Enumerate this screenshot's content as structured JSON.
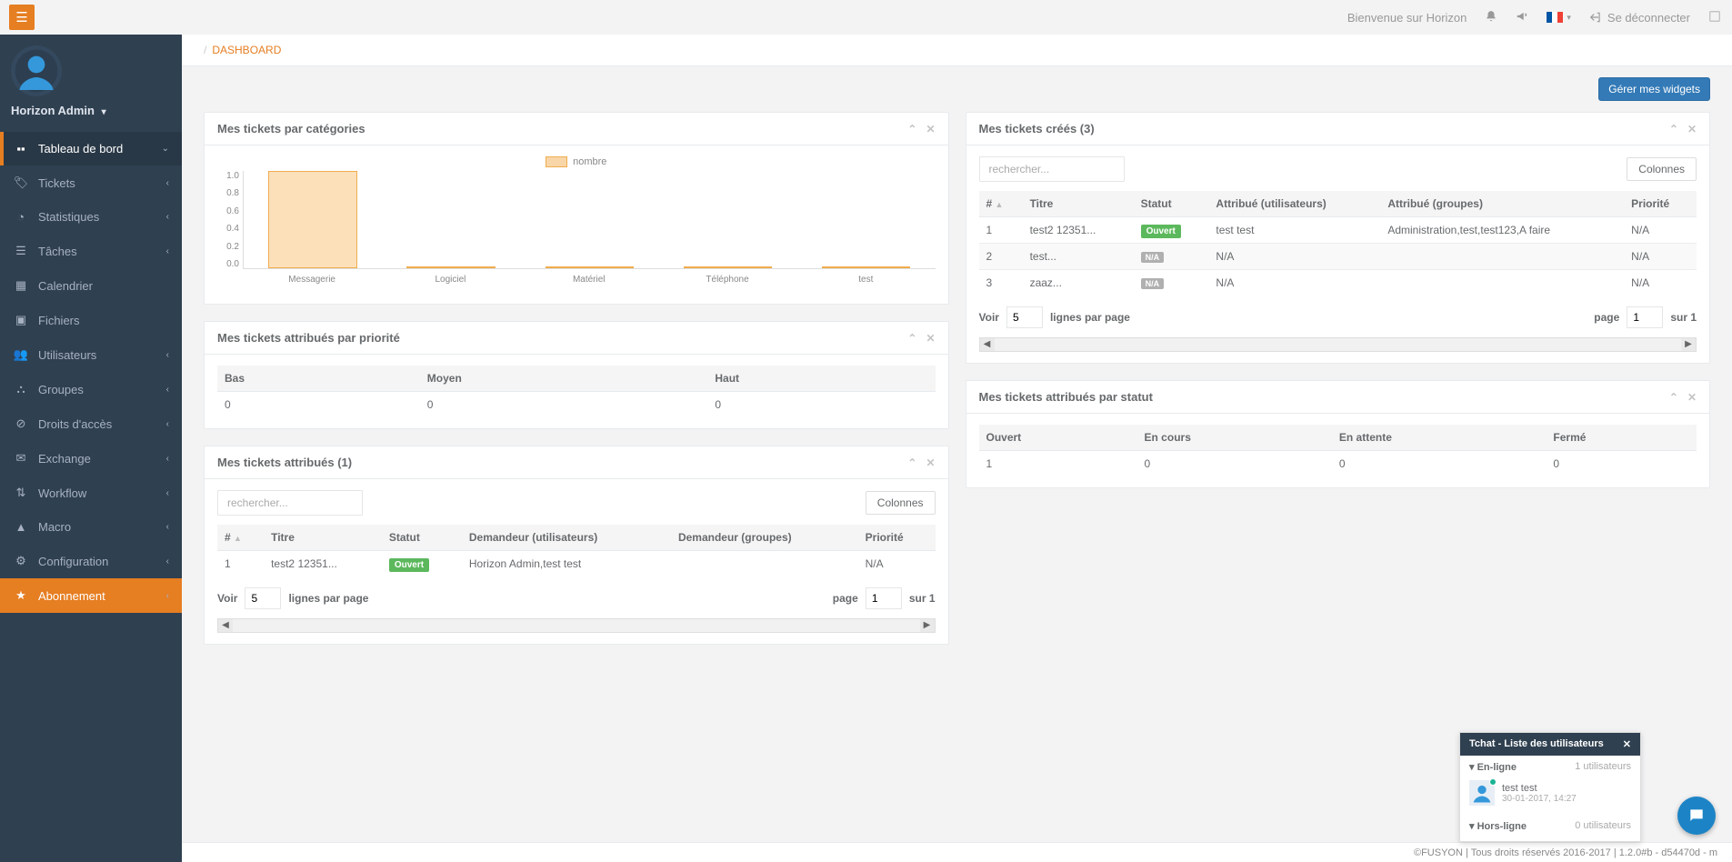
{
  "topbar": {
    "welcome": "Bienvenue sur Horizon",
    "logout": "Se déconnecter"
  },
  "profile": {
    "username": "Horizon Admin"
  },
  "sidebar": {
    "items": [
      {
        "icon": "dashboard",
        "label": "Tableau de bord",
        "active": true
      },
      {
        "icon": "tag",
        "label": "Tickets"
      },
      {
        "icon": "dashboard",
        "label": "Statistiques"
      },
      {
        "icon": "list",
        "label": "Tâches"
      },
      {
        "icon": "calendar",
        "label": "Calendrier"
      },
      {
        "icon": "folder",
        "label": "Fichiers"
      },
      {
        "icon": "users",
        "label": "Utilisateurs"
      },
      {
        "icon": "group",
        "label": "Groupes"
      },
      {
        "icon": "lock",
        "label": "Droits d'accès"
      },
      {
        "icon": "envelope",
        "label": "Exchange"
      },
      {
        "icon": "workflow",
        "label": "Workflow"
      },
      {
        "icon": "macro",
        "label": "Macro"
      },
      {
        "icon": "gear",
        "label": "Configuration"
      },
      {
        "icon": "star",
        "label": "Abonnement",
        "highlight": true
      }
    ]
  },
  "breadcrumb": "DASHBOARD",
  "buttons": {
    "manage_widgets": "Gérer mes widgets",
    "columns": "Colonnes"
  },
  "widgets": {
    "by_category": {
      "title": "Mes tickets par catégories",
      "legend": "nombre"
    },
    "by_priority": {
      "title": "Mes tickets attribués par priorité",
      "headers": {
        "low": "Bas",
        "medium": "Moyen",
        "high": "Haut"
      },
      "values": {
        "low": "0",
        "medium": "0",
        "high": "0"
      }
    },
    "assigned": {
      "title": "Mes tickets attribués (1)",
      "search_placeholder": "rechercher...",
      "headers": {
        "num": "#",
        "title": "Titre",
        "status": "Statut",
        "req_users": "Demandeur (utilisateurs)",
        "req_groups": "Demandeur (groupes)",
        "priority": "Priorité"
      },
      "rows": [
        {
          "num": "1",
          "title": "test2 12351...",
          "status": "Ouvert",
          "req_users": "Horizon Admin,test test",
          "req_groups": "",
          "priority": "N/A"
        }
      ]
    },
    "created": {
      "title": "Mes tickets créés (3)",
      "search_placeholder": "rechercher...",
      "headers": {
        "num": "#",
        "title": "Titre",
        "status": "Statut",
        "assigned_users": "Attribué (utilisateurs)",
        "assigned_groups": "Attribué (groupes)",
        "priority": "Priorité"
      },
      "rows": [
        {
          "num": "1",
          "title": "test2 12351...",
          "status": "Ouvert",
          "status_kind": "open",
          "assigned_users": "test test",
          "assigned_groups": "Administration,test,test123,A faire",
          "priority": "N/A"
        },
        {
          "num": "2",
          "title": "test...",
          "status": "N/A",
          "status_kind": "na",
          "assigned_users": "N/A",
          "assigned_groups": "",
          "priority": "N/A"
        },
        {
          "num": "3",
          "title": "zaaz...",
          "status": "N/A",
          "status_kind": "na",
          "assigned_users": "N/A",
          "assigned_groups": "",
          "priority": "N/A"
        }
      ]
    },
    "by_status": {
      "title": "Mes tickets attribués par statut",
      "headers": {
        "open": "Ouvert",
        "progress": "En cours",
        "waiting": "En attente",
        "closed": "Fermé"
      },
      "values": {
        "open": "1",
        "progress": "0",
        "waiting": "0",
        "closed": "0"
      }
    }
  },
  "footer": "©FUSYON | Tous droits réservés 2016-2017 | 1.2.0#b - d54470d - m",
  "pager": {
    "show": "Voir",
    "lines_per_page": "lignes par page",
    "page_label": "page",
    "of_label": "sur 1",
    "page_size": "5",
    "page_num": "1"
  },
  "chat": {
    "title": "Tchat - Liste des utilisateurs",
    "online_label": "En-ligne",
    "online_count": "1 utilisateurs",
    "offline_label": "Hors-ligne",
    "offline_count": "0 utilisateurs",
    "user": {
      "name": "test test",
      "time": "30-01-2017, 14:27"
    }
  },
  "chart_data": {
    "type": "bar",
    "categories": [
      "Messagerie",
      "Logiciel",
      "Matériel",
      "Téléphone",
      "test"
    ],
    "values": [
      1,
      0,
      0,
      0,
      0
    ],
    "legend": "nombre",
    "ylim": [
      0,
      1
    ],
    "yticks": [
      0,
      0.2,
      0.4,
      0.6,
      0.8,
      1.0
    ]
  }
}
